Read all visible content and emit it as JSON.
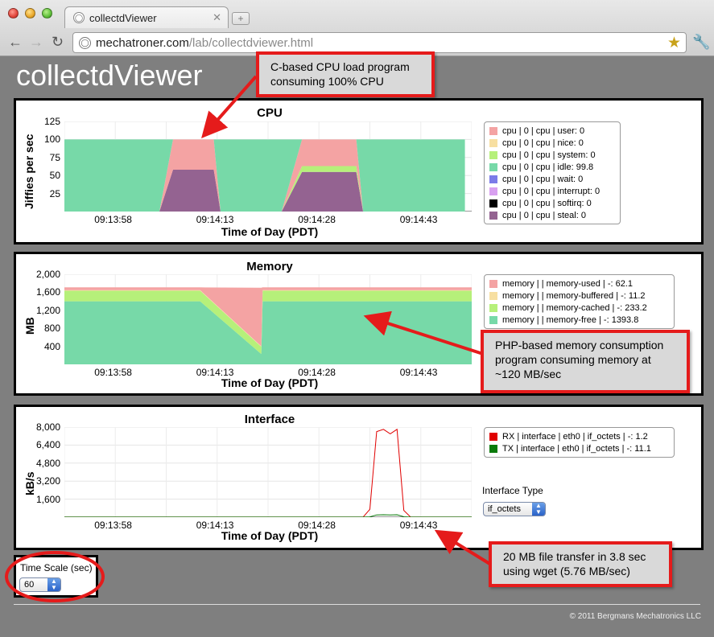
{
  "browser": {
    "tab_title": "collectdViewer",
    "url_host": "mechatroner.com",
    "url_path": "/lab/collectdviewer.html"
  },
  "app_title": "collectdViewer",
  "charts": {
    "cpu": {
      "title": "CPU",
      "ylabel": "Jiffies per sec",
      "xlabel": "Time of Day (PDT)",
      "yticks": [
        "125",
        "100",
        "75",
        "50",
        "25"
      ],
      "xticks": [
        "09:13:58",
        "09:14:13",
        "09:14:28",
        "09:14:43"
      ],
      "legend": [
        {
          "label": "cpu | 0 | cpu | user:  0",
          "color": "#f4a3a3"
        },
        {
          "label": "cpu | 0 | cpu | nice:  0",
          "color": "#f7dfa1"
        },
        {
          "label": "cpu | 0 | cpu | system:  0",
          "color": "#b6f07a"
        },
        {
          "label": "cpu | 0 | cpu | idle:  99.8",
          "color": "#77d9a8"
        },
        {
          "label": "cpu | 0 | cpu | wait:  0",
          "color": "#7b7be8"
        },
        {
          "label": "cpu | 0 | cpu | interrupt:  0",
          "color": "#d8a0f0"
        },
        {
          "label": "cpu | 0 | cpu | softirq:  0",
          "color": "#000000"
        },
        {
          "label": "cpu | 0 | cpu | steal:  0",
          "color": "#946391"
        }
      ]
    },
    "memory": {
      "title": "Memory",
      "ylabel": "MB",
      "xlabel": "Time of Day (PDT)",
      "yticks": [
        "2,000",
        "1,600",
        "1,200",
        "800",
        "400"
      ],
      "xticks": [
        "09:13:58",
        "09:14:13",
        "09:14:28",
        "09:14:43"
      ],
      "legend": [
        {
          "label": "memory |  | memory-used | -:  62.1",
          "color": "#f4a3a3"
        },
        {
          "label": "memory |  | memory-buffered | -:  11.2",
          "color": "#f7dfa1"
        },
        {
          "label": "memory |  | memory-cached | -:  233.2",
          "color": "#b6f07a"
        },
        {
          "label": "memory |  | memory-free | -:  1393.8",
          "color": "#77d9a8"
        }
      ]
    },
    "interface": {
      "title": "Interface",
      "ylabel": "kB/s",
      "xlabel": "Time of Day (PDT)",
      "yticks": [
        "8,000",
        "6,400",
        "4,800",
        "3,200",
        "1,600"
      ],
      "xticks": [
        "09:13:58",
        "09:14:13",
        "09:14:28",
        "09:14:43"
      ],
      "legend": [
        {
          "label": "RX | interface | eth0 | if_octets | -:  1.2",
          "color": "#e00000"
        },
        {
          "label": "TX | interface | eth0 | if_octets | -:  11.1",
          "color": "#0a7a0a"
        }
      ],
      "type_label": "Interface Type",
      "type_value": "if_octets"
    }
  },
  "chart_data": [
    {
      "type": "area",
      "title": "CPU",
      "xlabel": "Time of Day (PDT)",
      "ylabel": "Jiffies per sec",
      "ylim": [
        0,
        125
      ],
      "x": [
        0,
        13,
        14,
        16,
        22,
        23,
        25,
        31,
        32,
        35,
        43,
        44,
        46,
        55,
        56,
        59
      ],
      "series": [
        {
          "name": "steal",
          "values": [
            0,
            0,
            0,
            58,
            58,
            0,
            0,
            0,
            0,
            55,
            55,
            0,
            0,
            0,
            0,
            0
          ]
        },
        {
          "name": "system",
          "values": [
            0,
            0,
            0,
            0,
            0,
            0,
            0,
            0,
            0,
            8,
            8,
            0,
            0,
            0,
            0,
            0
          ]
        },
        {
          "name": "user",
          "values": [
            0,
            0,
            0,
            42,
            42,
            0,
            0,
            0,
            0,
            37,
            37,
            0,
            0,
            0,
            0,
            0
          ]
        },
        {
          "name": "idle",
          "values": [
            100,
            100,
            100,
            0,
            0,
            100,
            100,
            100,
            100,
            0,
            0,
            100,
            100,
            100,
            100,
            100
          ]
        }
      ]
    },
    {
      "type": "area",
      "title": "Memory",
      "xlabel": "Time of Day (PDT)",
      "ylabel": "MB",
      "ylim": [
        0,
        2000
      ],
      "x": [
        0,
        20,
        29,
        29.2,
        60
      ],
      "series": [
        {
          "name": "memory-free",
          "values": [
            1400,
            1400,
            230,
            1400,
            1400
          ]
        },
        {
          "name": "memory-cached",
          "values": [
            235,
            235,
            160,
            235,
            235
          ]
        },
        {
          "name": "memory-buffered",
          "values": [
            12,
            12,
            12,
            12,
            12
          ]
        },
        {
          "name": "memory-used",
          "values": [
            62,
            62,
            1300,
            62,
            62
          ]
        }
      ]
    },
    {
      "type": "line",
      "title": "Interface",
      "xlabel": "Time of Day (PDT)",
      "ylabel": "kB/s",
      "ylim": [
        0,
        8000
      ],
      "x": [
        0,
        44,
        45,
        46,
        47,
        48,
        49,
        50,
        51,
        52,
        60
      ],
      "series": [
        {
          "name": "RX",
          "values": [
            5,
            5,
            700,
            7600,
            7800,
            7400,
            7800,
            600,
            5,
            5,
            5
          ]
        },
        {
          "name": "TX",
          "values": [
            8,
            8,
            30,
            200,
            210,
            200,
            210,
            40,
            8,
            8,
            8
          ]
        }
      ]
    }
  ],
  "time_scale": {
    "label": "Time Scale (sec)",
    "value": "60"
  },
  "callouts": {
    "cpu": "C-based CPU load program consuming 100% CPU",
    "memory": "PHP-based memory consumption program consuming memory at ~120 MB/sec",
    "network": "20 MB file transfer in 3.8 sec using wget (5.76 MB/sec)"
  },
  "footer": "© 2011 Bergmans Mechatronics LLC"
}
